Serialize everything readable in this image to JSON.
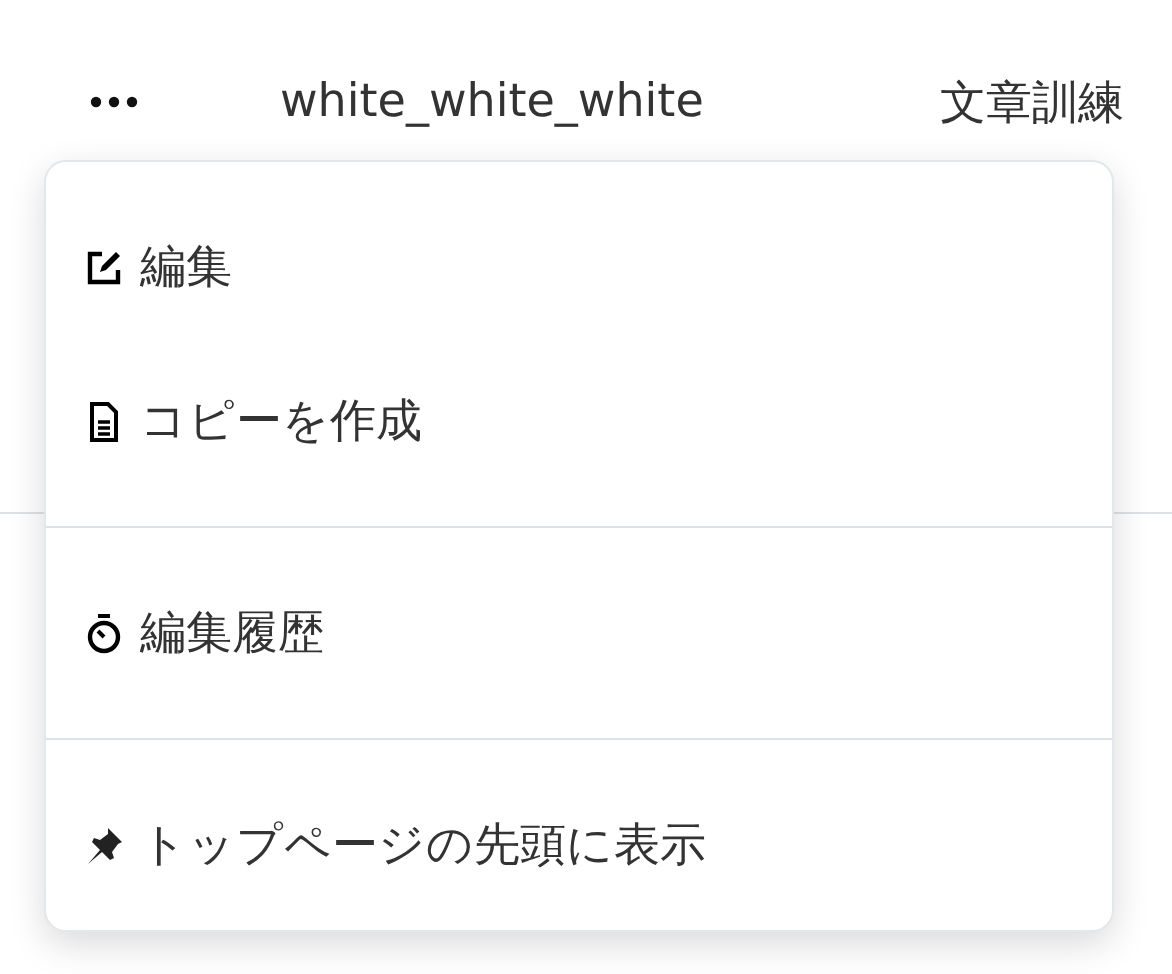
{
  "header": {
    "title": "white_white_white",
    "category": "文章訓練"
  },
  "menu": {
    "groups": [
      {
        "items": [
          {
            "label": "編集"
          },
          {
            "label": "コピーを作成"
          }
        ]
      },
      {
        "items": [
          {
            "label": "編集履歴"
          }
        ]
      },
      {
        "items": [
          {
            "label": "トップページの先頭に表示"
          }
        ]
      }
    ]
  }
}
